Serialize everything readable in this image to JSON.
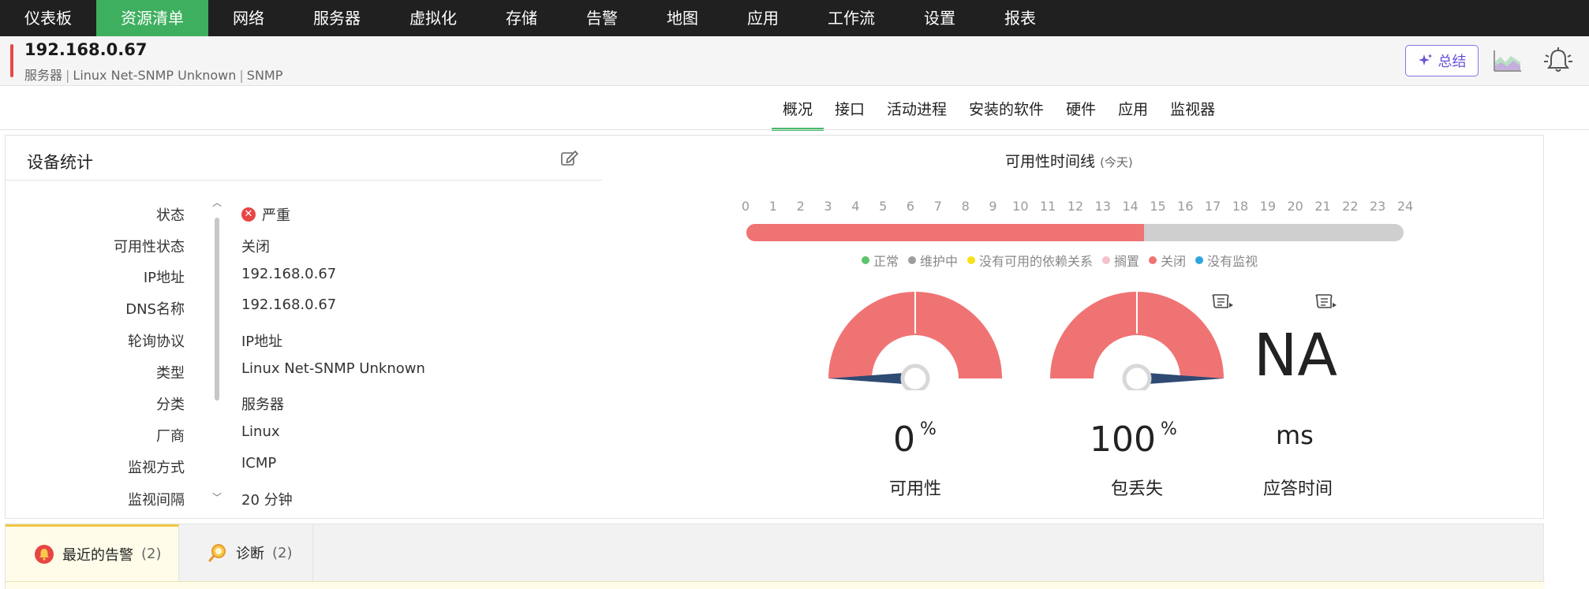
{
  "nav": {
    "items": [
      "仪表板",
      "资源清单",
      "网络",
      "服务器",
      "虚拟化",
      "存储",
      "告警",
      "地图",
      "应用",
      "工作流",
      "设置",
      "报表"
    ],
    "active_index": 1
  },
  "device": {
    "ip": "192.168.0.67",
    "category": "服务器",
    "type": "Linux Net-SNMP Unknown",
    "protocol": "SNMP",
    "summary_button": "总结"
  },
  "tabs": [
    "概况",
    "接口",
    "活动进程",
    "安装的软件",
    "硬件",
    "应用",
    "监视器"
  ],
  "stats": {
    "title": "设备统计",
    "rows": [
      {
        "label": "状态",
        "value": "严重"
      },
      {
        "label": "可用性状态",
        "value": "关闭"
      },
      {
        "label": "IP地址",
        "value": "192.168.0.67"
      },
      {
        "label": "DNS名称",
        "value": "192.168.0.67"
      },
      {
        "label": "轮询协议",
        "value": "IP地址"
      },
      {
        "label": "类型",
        "value": "Linux Net-SNMP Unknown"
      },
      {
        "label": "分类",
        "value": "服务器"
      },
      {
        "label": "厂商",
        "value": "Linux"
      },
      {
        "label": "监视方式",
        "value": "ICMP"
      },
      {
        "label": "监视间隔",
        "value": "20 分钟"
      }
    ]
  },
  "timeline": {
    "title": "可用性时间线",
    "subtitle": "(今天)",
    "hours": [
      "0",
      "1",
      "2",
      "3",
      "4",
      "5",
      "6",
      "7",
      "8",
      "9",
      "10",
      "11",
      "12",
      "13",
      "14",
      "15",
      "16",
      "17",
      "18",
      "19",
      "20",
      "21",
      "22",
      "23",
      "24"
    ],
    "down_fraction": 0.605,
    "legend": [
      {
        "label": "正常",
        "color": "#5cc36e"
      },
      {
        "label": "维护中",
        "color": "#9e9e9e"
      },
      {
        "label": "没有可用的依赖关系",
        "color": "#f4e21a"
      },
      {
        "label": "搁置",
        "color": "#f6bfcc"
      },
      {
        "label": "关闭",
        "color": "#f07374"
      },
      {
        "label": "没有监视",
        "color": "#2ea6e0"
      }
    ]
  },
  "gauges": {
    "availability": {
      "value": "0",
      "unit": "%",
      "label": "可用性",
      "level": 0
    },
    "packet_loss": {
      "value": "100",
      "unit": "%",
      "label": "包丢失",
      "level": 100
    },
    "response": {
      "value": "NA",
      "unit": "ms",
      "label": "应答时间"
    }
  },
  "colors": {
    "accent": "#3eaf5e",
    "critical": "#e84545",
    "down": "#f07374",
    "needle": "#2f4a73"
  },
  "bottom_tabs": [
    {
      "label": "最近的告警",
      "count": "(2)"
    },
    {
      "label": "诊断",
      "count": "(2)"
    }
  ]
}
